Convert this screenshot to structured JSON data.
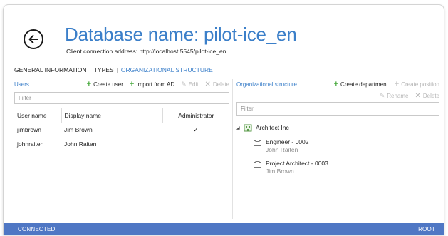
{
  "header": {
    "title": "Database name: pilot-ice_en",
    "address": "Client connection address: http://localhost:5545/pilot-ice_en"
  },
  "tabs": [
    {
      "label": "GENERAL INFORMATION",
      "active": false
    },
    {
      "label": "TYPES",
      "active": false
    },
    {
      "label": "ORGANIZATIONAL STRUCTURE",
      "active": true
    }
  ],
  "users_panel": {
    "title": "Users",
    "create_user": "Create user",
    "import_ad": "Import from AD",
    "edit": "Edit",
    "delete": "Delete",
    "filter_placeholder": "Filter",
    "columns": [
      "User name",
      "Display name",
      "Administrator"
    ],
    "rows": [
      {
        "username": "jimbrown",
        "display": "Jim Brown",
        "admin": "✓"
      },
      {
        "username": "johnraiten",
        "display": "John Raiten",
        "admin": ""
      }
    ]
  },
  "org_panel": {
    "title": "Organizational structure",
    "create_department": "Create department",
    "create_position": "Create position",
    "rename": "Rename",
    "delete": "Delete",
    "filter_placeholder": "Filter",
    "root": "Architect Inc",
    "positions": [
      {
        "name": "Engineer - 0002",
        "person": "John Raiten"
      },
      {
        "name": "Project Architect - 0003",
        "person": "Jim Brown"
      }
    ]
  },
  "statusbar": {
    "left": "CONNECTED",
    "right": "ROOT"
  },
  "colors": {
    "accent": "#3b7fc9",
    "statusbar": "#4f77c4",
    "add_icon": "#45a83a"
  },
  "icons": {
    "back": "arrow-left-circle-icon",
    "add": "plus-icon",
    "edit": "pencil-icon",
    "delete": "x-icon",
    "organization": "organization-icon",
    "position": "position-icon",
    "expander": "triangle-expanded-icon"
  }
}
